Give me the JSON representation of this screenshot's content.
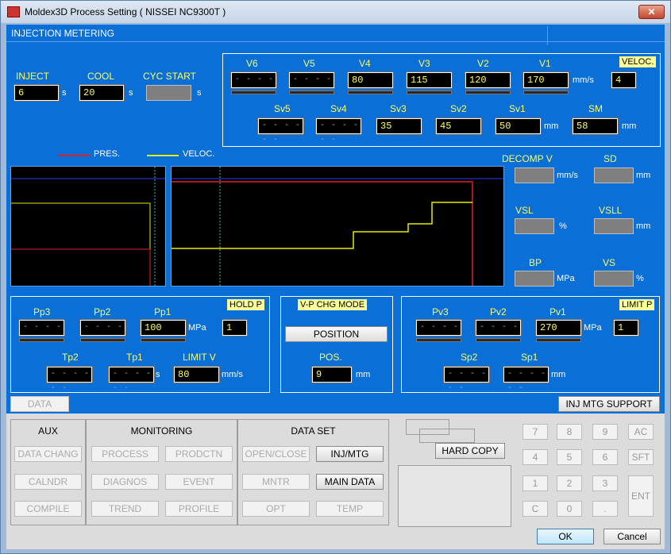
{
  "window": {
    "title": "Moldex3D Process Setting ( NISSEI NC9300T )",
    "close_label": "✕"
  },
  "header": {
    "title": "INJECTION METERING"
  },
  "times": {
    "inject": {
      "label": "INJECT",
      "value": "6",
      "unit": "s"
    },
    "cool": {
      "label": "COOL",
      "value": "20",
      "unit": "s"
    },
    "cyc_start": {
      "label": "CYC START",
      "value": "",
      "unit": "s"
    }
  },
  "velocity": {
    "labels": [
      "V6",
      "V5",
      "V4",
      "V3",
      "V2",
      "V1"
    ],
    "values": [
      "- - - - - -",
      "- - - - - -",
      "80",
      "115",
      "120",
      "170"
    ],
    "unit": "mm/s",
    "veloc_label": "VELOC.",
    "veloc_value": "4",
    "pos_labels": [
      "Sv5",
      "Sv4",
      "Sv3",
      "Sv2",
      "Sv1",
      "SM"
    ],
    "pos_values": [
      "- - - - - -",
      "- - - - - -",
      "35",
      "45",
      "50",
      "58"
    ],
    "pos_unit": "mm"
  },
  "legend": {
    "pres": "PRES.",
    "veloc": "VELOC."
  },
  "decomp": {
    "decomp_v": {
      "label": "DECOMP V",
      "unit": "mm/s"
    },
    "sd": {
      "label": "SD",
      "unit": "mm"
    },
    "vsl": {
      "label": "VSL",
      "unit": "%"
    },
    "vsll": {
      "label": "VSLL",
      "unit": "mm"
    },
    "bp": {
      "label": "BP",
      "unit": "MPa"
    },
    "vs": {
      "label": "VS",
      "unit": "%"
    }
  },
  "hold": {
    "labels": [
      "Pp3",
      "Pp2",
      "Pp1"
    ],
    "values": [
      "- - - - - -",
      "- - - - - -",
      "100"
    ],
    "unit": "MPa",
    "hold_label": "HOLD P",
    "hold_value": "1",
    "time_labels": [
      "Tp2",
      "Tp1"
    ],
    "time_values": [
      "- - - - - -",
      "- - - - - -"
    ],
    "time_unit": "s",
    "limit_v_label": "LIMIT V",
    "limit_v_value": "80",
    "limit_v_unit": "mm/s"
  },
  "vp": {
    "title": "V-P CHG MODE",
    "mode_button": "POSITION",
    "pos_label": "POS.",
    "pos_value": "9",
    "pos_unit": "mm"
  },
  "limitp": {
    "labels": [
      "Pv3",
      "Pv2",
      "Pv1"
    ],
    "values": [
      "- - - - - -",
      "- - - - - -",
      "270"
    ],
    "unit": "MPa",
    "limit_label": "LIMIT P",
    "limit_value": "1",
    "pos_labels": [
      "Sp2",
      "Sp1"
    ],
    "pos_values": [
      "- - - - - -",
      "- - - - - -"
    ],
    "pos_unit": "mm"
  },
  "data_tab": "DATA",
  "support_button": "INJ MTG SUPPORT",
  "aux": {
    "title": "AUX",
    "items": [
      "DATA CHANG",
      "CALNDR",
      "COMPILE"
    ]
  },
  "monitoring": {
    "title": "MONITORING",
    "col1": [
      "PROCESS",
      "DIAGNOS",
      "TREND"
    ],
    "col2": [
      "PRODCTN",
      "EVENT",
      "PROFILE"
    ]
  },
  "dataset": {
    "title": "DATA SET",
    "col1": [
      "OPEN/CLOSE",
      "MNTR",
      "OPT"
    ],
    "col2": [
      "INJ/MTG",
      "MAIN DATA",
      "TEMP"
    ]
  },
  "hard_copy": "HARD COPY",
  "keypad": {
    "keys": [
      "7",
      "8",
      "9",
      "AC",
      "4",
      "5",
      "6",
      "SFT",
      "1",
      "2",
      "3",
      "C",
      "0",
      "."
    ],
    "ent": "ENT"
  },
  "footer": {
    "ok": "OK",
    "cancel": "Cancel"
  },
  "colors": {
    "pressure": "#e02020",
    "velocity": "#e8e800",
    "panel": "#0a6fd6",
    "label": "#ffff66"
  }
}
